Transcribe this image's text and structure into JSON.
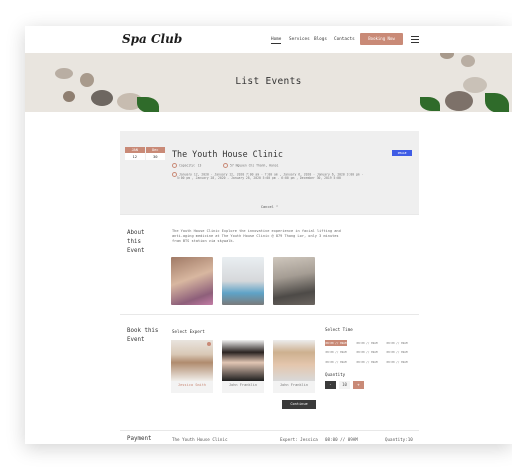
{
  "header": {
    "logo": "Spa Club",
    "nav": [
      "Home",
      "Services",
      "Blogs",
      "Contacts"
    ],
    "booking_button": "Booking Now",
    "menu_icon": "hamburger-menu-icon"
  },
  "banner": {
    "title": "List Events"
  },
  "event": {
    "date": {
      "months": [
        "JAN",
        "Dec"
      ],
      "days": [
        "12",
        "30"
      ]
    },
    "title": "The Youth House Clinic",
    "badge": "IMAGE",
    "guests": "Capacity: 13",
    "address": "57 Nguyen Chi Thanh, Hanoi",
    "schedule_line1": "January 12, 2020 - January 12, 2020 7:00 am - 7:00 am  ,  January 6, 2020 - January 6, 2020 3:00 pm -",
    "schedule_line2": "5:00 pm  ,  January 28, 2020 - January 28, 2020 5:00 pm - 6:00 pm  ,  December 30, 2019 5:00",
    "cancel": "Cancel ^"
  },
  "about": {
    "title_lines": [
      "About",
      "this",
      "Event"
    ],
    "text_lines": [
      "The Youth House Clinic Explore the innovative experience in facial lifting and",
      "anti-aging medicine at The Youth House Clinic @ 879 Thong Lor, only 3 minutes",
      "from BTS station via skywalk."
    ]
  },
  "booking": {
    "title_lines": [
      "Book this",
      "Event"
    ],
    "select_expert": "Select Expert",
    "experts": [
      "Jessica Smith",
      "John Franklin",
      "John Franklin"
    ],
    "select_time": "Select Time",
    "times": [
      [
        "08:00 // 09AM",
        "08:00 // 09AM",
        "08:00 // 09AM"
      ],
      [
        "08:00 // 09AM",
        "08:00 // 09AM",
        "08:00 // 09AM"
      ],
      [
        "08:00 // 09AM",
        "08:00 // 09AM",
        "08:00 // 09AM"
      ]
    ],
    "quantity_label": "Quantity",
    "quantity": {
      "minus": "-",
      "value": "10",
      "plus": "+"
    },
    "continue": "Continue"
  },
  "payment": {
    "title": "Payment",
    "event": "The Youth House Clinic",
    "expert": "Expert: Jessica",
    "time": "08:00 // 09AM",
    "quantity": "Quantity:10"
  },
  "colors": {
    "accent": "#c98a77",
    "badge": "#3f5ce5",
    "dark_button": "#3a3a3a"
  }
}
